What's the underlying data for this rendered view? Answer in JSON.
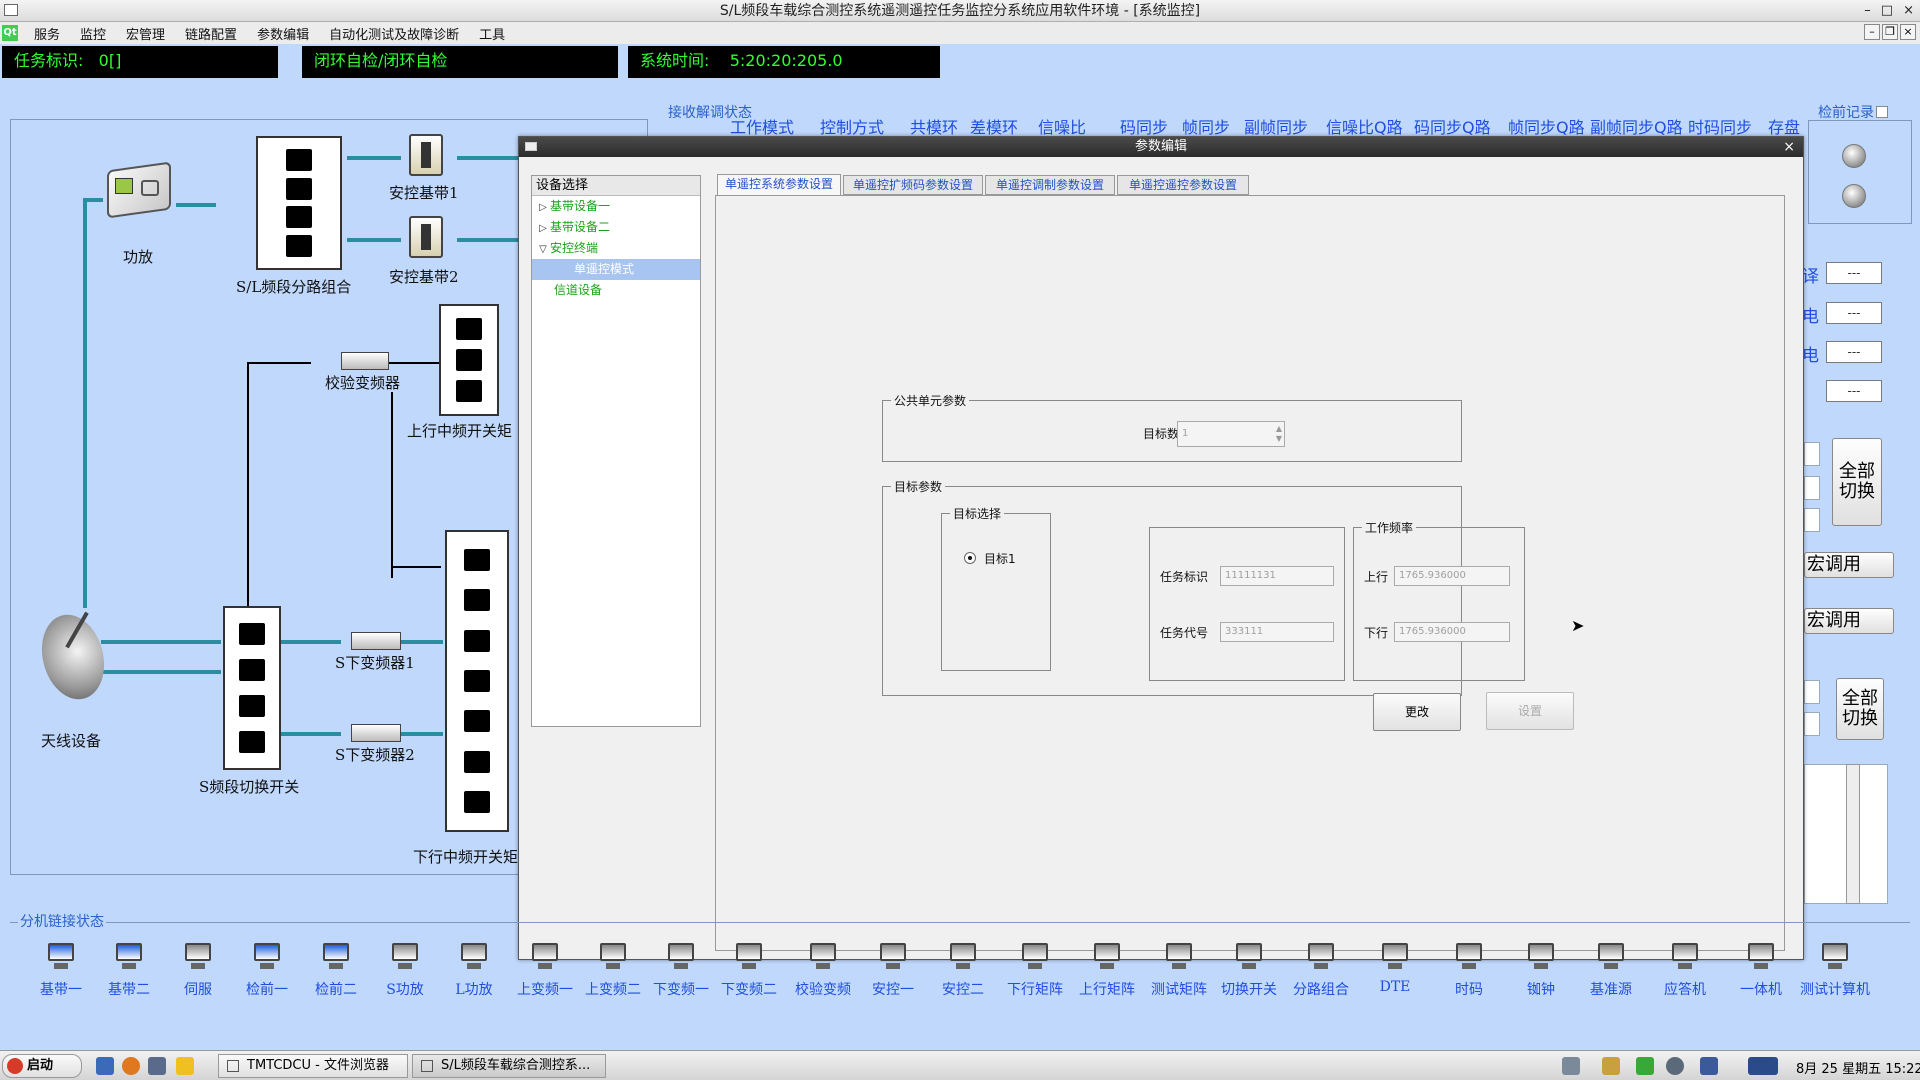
{
  "window": {
    "title": "S/L频段车载综合测控系统遥测遥控任务监控分系统应用软件环境 - [系统监控]"
  },
  "menu": [
    "服务",
    "监控",
    "宏管理",
    "链路配置",
    "参数编辑",
    "自动化测试及故障诊断",
    "工具"
  ],
  "status": {
    "task_id": "任务标识:   0[]",
    "mode": "闭环自检/闭环自检",
    "system_time": "系统时间:    5:20:20:205.0"
  },
  "diagram": {
    "labels": {
      "power_amp": "功放",
      "splitter": "S/L频段分路组合",
      "baseband1": "安控基带1",
      "baseband2": "安控基带2",
      "verify_converter": "校验变频器",
      "up_if_matrix": "上行中频开关矩",
      "antenna": "天线设备",
      "s_switch": "S频段切换开关",
      "s_down1": "S下变频器1",
      "s_down2": "S下变频器2",
      "down_if_matrix": "下行中频开关矩"
    }
  },
  "demod_status": {
    "title": "接收解调状态",
    "columns": [
      "工作模式",
      "控制方式",
      "共模环",
      "差模环",
      "信噪比",
      "码同步",
      "帧同步",
      "副帧同步",
      "信噪比Q路",
      "码同步Q路",
      "帧同步Q路",
      "副帧同步Q路",
      "时码同步",
      "存盘"
    ]
  },
  "right_panel": {
    "title": "检前记录",
    "labels": [
      "译",
      "电",
      "电"
    ],
    "boxes": [
      "---",
      "---",
      "---",
      "---"
    ],
    "all_switch": "全部\n切换",
    "macro_call": "宏调用"
  },
  "dialog": {
    "title": "参数编辑",
    "close": "×",
    "tree": {
      "header": "设备选择",
      "items": [
        {
          "label": "基带设备一",
          "expander": "▷"
        },
        {
          "label": "基带设备二",
          "expander": "▷"
        },
        {
          "label": "安控终端",
          "expander": "▽"
        },
        {
          "label": "单遥控模式",
          "expander": ""
        },
        {
          "label": "信道设备",
          "expander": ""
        }
      ]
    },
    "tabs": [
      "单遥控系统参数设置",
      "单遥控扩频码参数设置",
      "单遥控调制参数设置",
      "单遥控遥控参数设置"
    ],
    "public_group": {
      "title": "公共单元参数",
      "target_count_label": "目标数",
      "target_count_value": "1"
    },
    "target_group": {
      "title": "目标参数",
      "select_title": "目标选择",
      "target1": "目标1",
      "task_id_label": "任务标识",
      "task_id_value": "11111131",
      "task_code_label": "任务代号",
      "task_code_value": "333111",
      "freq_title": "工作频率",
      "up_label": "上行",
      "up_value": "1765.936000",
      "down_label": "下行",
      "down_value": "1765.936000",
      "modify": "更改",
      "set": "设置"
    }
  },
  "link_status": {
    "title": "分机链接状态",
    "devices": [
      {
        "name": "基带一",
        "color": "#1f5fd8"
      },
      {
        "name": "基带二",
        "color": "#1f5fd8"
      },
      {
        "name": "伺服",
        "color": "#888888"
      },
      {
        "name": "检前一",
        "color": "#1f5fd8"
      },
      {
        "name": "检前二",
        "color": "#1f5fd8"
      },
      {
        "name": "S功放",
        "color": "#888888"
      },
      {
        "name": "L功放",
        "color": "#888888"
      },
      {
        "name": "上变频一",
        "color": "#888888"
      },
      {
        "name": "上变频二",
        "color": "#888888"
      },
      {
        "name": "下变频一",
        "color": "#888888"
      },
      {
        "name": "下变频二",
        "color": "#888888"
      },
      {
        "name": "校验变频",
        "color": "#888888"
      },
      {
        "name": "安控一",
        "color": "#888888"
      },
      {
        "name": "安控二",
        "color": "#888888"
      },
      {
        "name": "下行矩阵",
        "color": "#888888"
      },
      {
        "name": "上行矩阵",
        "color": "#888888"
      },
      {
        "name": "测试矩阵",
        "color": "#888888"
      },
      {
        "name": "切换开关",
        "color": "#888888"
      },
      {
        "name": "分路组合",
        "color": "#888888"
      },
      {
        "name": "DTE",
        "color": "#888888"
      },
      {
        "name": "时码",
        "color": "#888888"
      },
      {
        "name": "铷钟",
        "color": "#888888"
      },
      {
        "name": "基准源",
        "color": "#888888"
      },
      {
        "name": "应答机",
        "color": "#888888"
      },
      {
        "name": "一体机",
        "color": "#888888"
      },
      {
        "name": "测试计算机",
        "color": "#888888"
      }
    ]
  },
  "taskbar": {
    "start": "启动",
    "tasks": [
      "TMTCDCU - 文件浏览器",
      "S/L频段车载综合测控系..."
    ],
    "clock": "8月 25 星期五 15:22"
  },
  "icons": [
    "qt-logo-icon",
    "power-amp-icon",
    "baseband-icon",
    "converter-icon",
    "antenna-dish-icon",
    "computer-icon",
    "browser-icon",
    "folder-icon",
    "volume-icon",
    "network-icon"
  ]
}
